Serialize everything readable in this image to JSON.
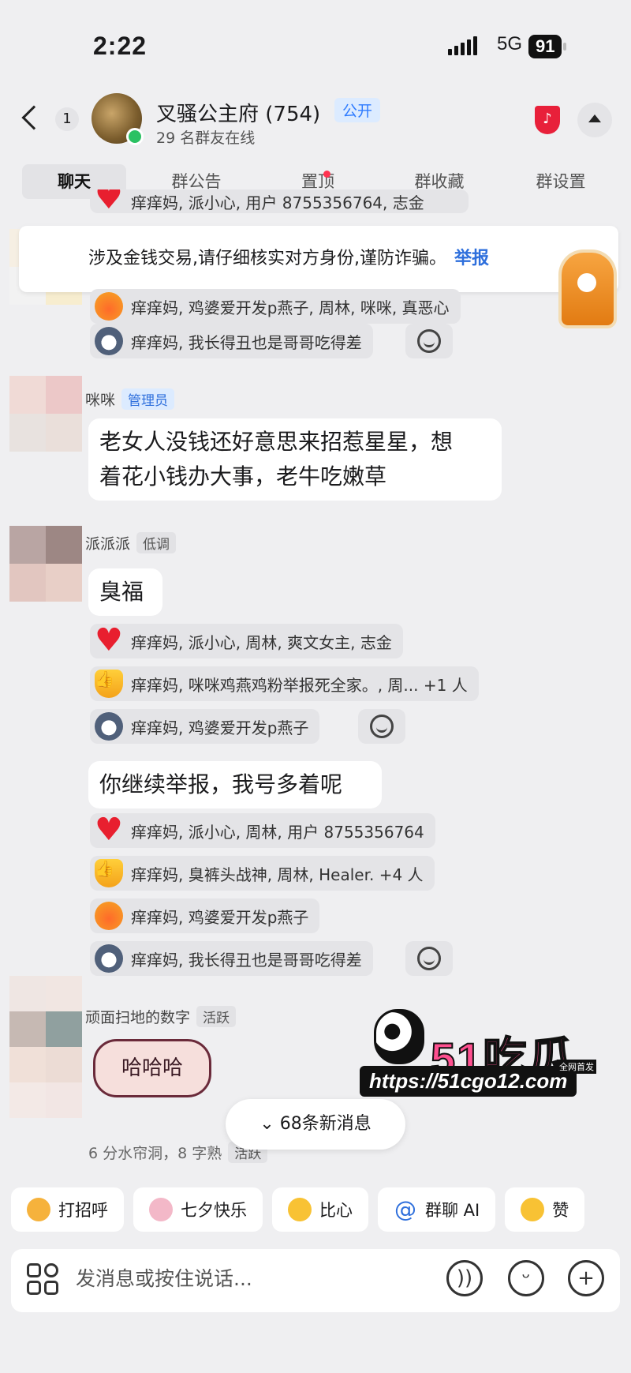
{
  "status_bar": {
    "time": "2:22",
    "network": "5G",
    "battery": "91"
  },
  "header": {
    "back_badge": "1",
    "group_name": "叉骚公主府 (754)",
    "public_tag": "公开",
    "online_count": "29 名群友在线"
  },
  "tabs": [
    "聊天",
    "群公告",
    "置顶",
    "群收藏",
    "群设置"
  ],
  "notice": {
    "text": "涉及金钱交易,请仔细核实对方身份,谨防诈骗。",
    "link": "举报"
  },
  "top_reactions": [
    {
      "icon": "heart",
      "text": "痒痒妈, 派小心, 用户 8755356764, 志金"
    },
    {
      "icon": "angry",
      "text": "痒痒妈, 鸡婆爱开发p燕子, 周林, 咪咪, 真恶心"
    },
    {
      "icon": "dog",
      "text": "痒痒妈, 我长得丑也是哥哥吃得差"
    }
  ],
  "messages": [
    {
      "sender": "咪咪",
      "tag": "管理员",
      "text_line1": "老女人没钱还好意思来招惹星星，想",
      "text_line2": "着花小钱办大事，老牛吃嫩草"
    },
    {
      "sender": "派派派",
      "tag": "低调",
      "text": "臭福"
    },
    {
      "text": "你继续举报，我号多着呢"
    },
    {
      "sender": "顽面扫地的数字",
      "tag": "活跃",
      "sticker": "哈哈哈"
    }
  ],
  "reactions_1": [
    {
      "icon": "heart",
      "text": "痒痒妈, 派小心, 周林, 爽文女主, 志金"
    },
    {
      "icon": "thumb",
      "text": "痒痒妈, 咪咪鸡燕鸡粉举报死全家。, 周... +1 人"
    },
    {
      "icon": "dog",
      "text": "痒痒妈, 鸡婆爱开发p燕子"
    }
  ],
  "reactions_2": [
    {
      "icon": "heart",
      "text": "痒痒妈, 派小心, 周林, 用户 8755356764"
    },
    {
      "icon": "thumb",
      "text": "痒痒妈, 臭裤头战神, 周林, Healer. +4 人"
    },
    {
      "icon": "angry",
      "text": "痒痒妈, 鸡婆爱开发p燕子"
    },
    {
      "icon": "dog",
      "text": "痒痒妈, 我长得丑也是哥哥吃得差"
    }
  ],
  "next_sender_line": "6 分水帘洞，8 字熟",
  "next_sender_tag": "活跃",
  "new_messages": "68条新消息",
  "quick_replies": [
    "打招呼",
    "七夕快乐",
    "比心",
    "群聊 AI",
    "赞"
  ],
  "input": {
    "placeholder": "发消息或按住说话..."
  },
  "watermark": {
    "brand": "51吃瓜",
    "url": "https://51cgo12.com",
    "small": "全网首发"
  }
}
